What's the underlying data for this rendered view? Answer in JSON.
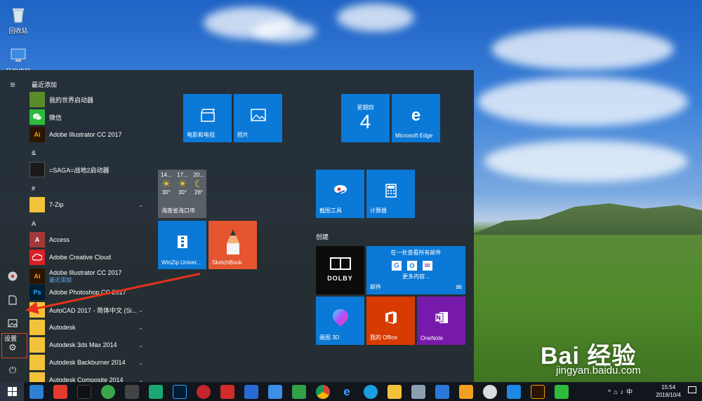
{
  "desktop": {
    "icons": [
      {
        "label": "回收站"
      },
      {
        "label": "我的电脑"
      }
    ]
  },
  "start_menu": {
    "rail": {
      "settings_tooltip": "设置"
    },
    "app_list": {
      "groups": [
        {
          "label": "最近添加"
        },
        {
          "label": "&"
        },
        {
          "label": "#"
        },
        {
          "label": "A"
        }
      ],
      "apps": [
        {
          "name": "我的世界启动器",
          "icon_color": "#5b8c2a",
          "icon_text": ""
        },
        {
          "name": "微信",
          "icon_color": "#2dbb3c",
          "icon_text": ""
        },
        {
          "name": "Adobe Illustrator CC 2017",
          "icon_color": "#2b1500",
          "icon_text": "Ai"
        },
        {
          "name": "=SAGA=战地2启动器",
          "icon_color": "#1a1a1a",
          "icon_text": ""
        },
        {
          "name": "7-Zip",
          "icon_color": "#f3c23b",
          "icon_text": ""
        },
        {
          "name": "Access",
          "icon_color": "#a4373a",
          "icon_text": "A"
        },
        {
          "name": "Adobe Creative Cloud",
          "icon_color": "#da1f26",
          "icon_text": ""
        },
        {
          "name": "Adobe Illustrator CC 2017",
          "sub": "最近添加",
          "icon_color": "#2b1500",
          "icon_text": "Ai"
        },
        {
          "name": "Adobe Photoshop CC 2017",
          "icon_color": "#001d34",
          "icon_text": "Ps"
        },
        {
          "name": "AutoCAD 2017 - 简体中文 (Si...",
          "icon_color": "#f3c23b",
          "icon_text": ""
        },
        {
          "name": "Autodesk",
          "icon_color": "#f3c23b",
          "icon_text": ""
        },
        {
          "name": "Autodesk 3ds Max 2014",
          "icon_color": "#f3c23b",
          "icon_text": ""
        },
        {
          "name": "Autodesk Backburner 2014",
          "icon_color": "#f3c23b",
          "icon_text": ""
        },
        {
          "name": "Autodesk Composite 2014",
          "icon_color": "#f3c23b",
          "icon_text": ""
        }
      ]
    },
    "tiles": {
      "movies": "电影和电视",
      "photos": "照片",
      "calendar_day": "星期四",
      "calendar_date": "4",
      "edge": "Microsoft Edge",
      "weather_days": [
        "14...",
        "17...",
        "20..."
      ],
      "weather_temps": [
        "30°",
        "30°",
        "28°"
      ],
      "weather_city": "海南省海口市",
      "snipping": "截图工具",
      "calculator": "计算器",
      "winzip": "WinZip Univer...",
      "sketchbook": "SketchBook",
      "section_create": "创建",
      "dolby": "DOLBY",
      "mail_header": "在一处查看所有邮件",
      "mail_more": "更多内容...",
      "mail": "邮件",
      "paint3d": "画图 3D",
      "office": "我的 Office",
      "onenote": "OneNote"
    }
  },
  "watermark": {
    "brand": "Bai 经验",
    "url": "jingyan.baidu.com"
  },
  "taskbar": {
    "time": "15:54",
    "date": "2018/10/4",
    "ime": "中"
  }
}
